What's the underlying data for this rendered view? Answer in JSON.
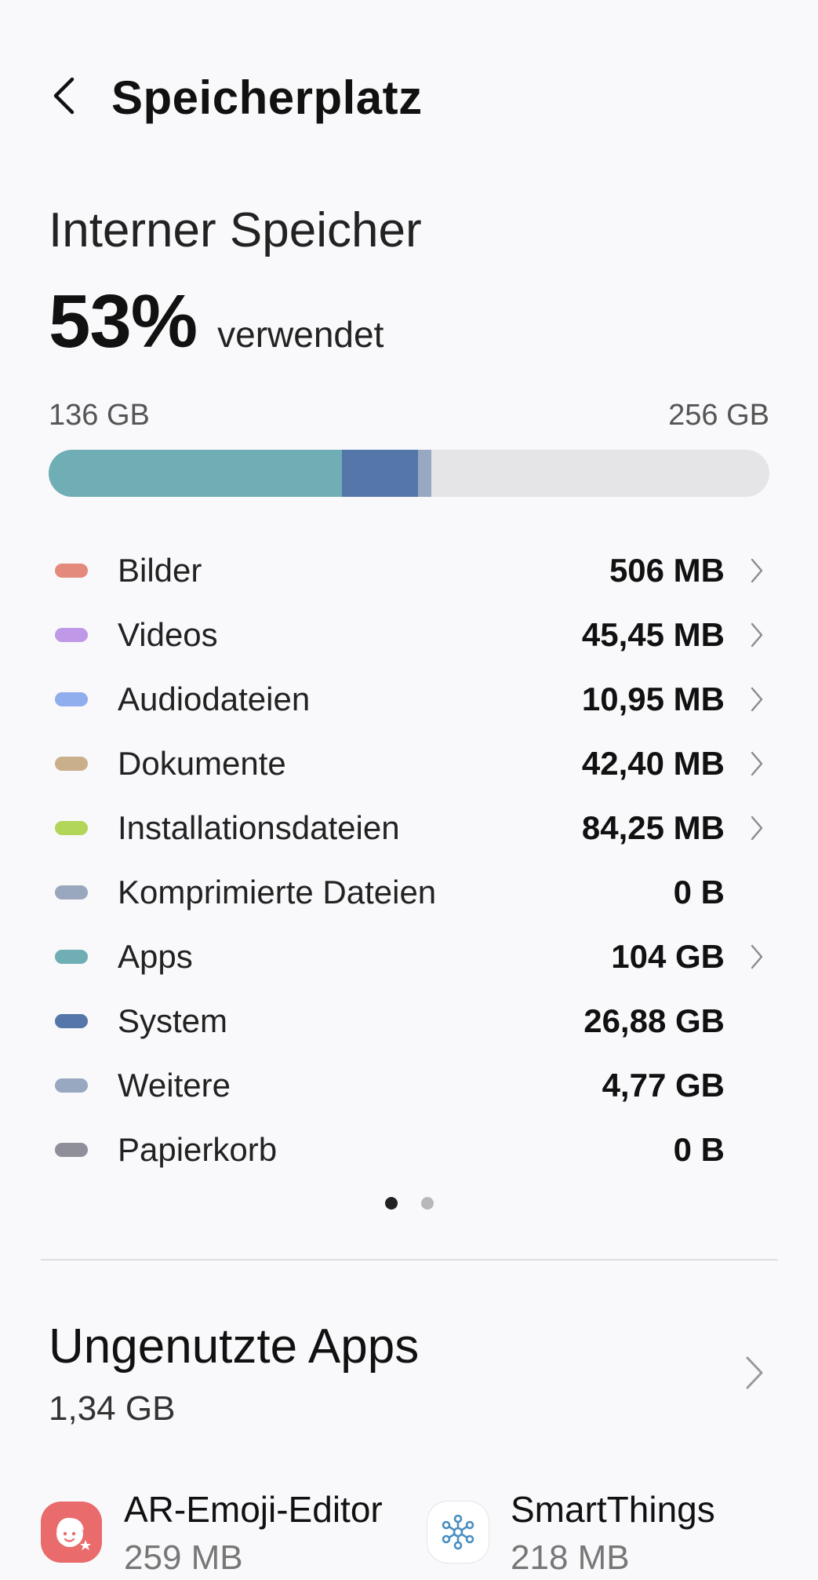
{
  "header": {
    "title": "Speicherplatz",
    "back_icon": "chevron-left-icon"
  },
  "storage": {
    "title": "Interner Speicher",
    "percent": "53%",
    "percent_label": "verwendet",
    "used": "136 GB",
    "total": "256 GB",
    "bar_segments": [
      {
        "name": "Apps",
        "fraction": 0.407,
        "color": "#6eaeb4"
      },
      {
        "name": "System",
        "fraction": 0.105,
        "color": "#5576a8"
      },
      {
        "name": "Weitere",
        "fraction": 0.019,
        "color": "#98a8c0"
      }
    ]
  },
  "categories": [
    {
      "label": "Bilder",
      "value": "506 MB",
      "color": "#e48a7c",
      "chevron": true
    },
    {
      "label": "Videos",
      "value": "45,45 MB",
      "color": "#bf98e8",
      "chevron": true
    },
    {
      "label": "Audiodateien",
      "value": "10,95 MB",
      "color": "#90adee",
      "chevron": true
    },
    {
      "label": "Dokumente",
      "value": "42,40 MB",
      "color": "#c9b08a",
      "chevron": true
    },
    {
      "label": "Installationsdateien",
      "value": "84,25 MB",
      "color": "#b2d659",
      "chevron": true
    },
    {
      "label": "Komprimierte Dateien",
      "value": "0 B",
      "color": "#9aa8bd",
      "chevron": false
    },
    {
      "label": "Apps",
      "value": "104 GB",
      "color": "#6eaeb4",
      "chevron": true
    },
    {
      "label": "System",
      "value": "26,88 GB",
      "color": "#5576a8",
      "chevron": false
    },
    {
      "label": "Weitere",
      "value": "4,77 GB",
      "color": "#98a8c0",
      "chevron": false
    },
    {
      "label": "Papierkorb",
      "value": "0 B",
      "color": "#8e8f99",
      "chevron": false
    }
  ],
  "pager": {
    "active": 0,
    "count": 2
  },
  "unused_apps": {
    "title": "Ungenutzte Apps",
    "size": "1,34 GB",
    "apps": [
      {
        "name": "AR-Emoji-Editor",
        "size": "259 MB",
        "icon": "ar-emoji-icon"
      },
      {
        "name": "SmartThings",
        "size": "218 MB",
        "icon": "smartthings-icon"
      }
    ]
  }
}
